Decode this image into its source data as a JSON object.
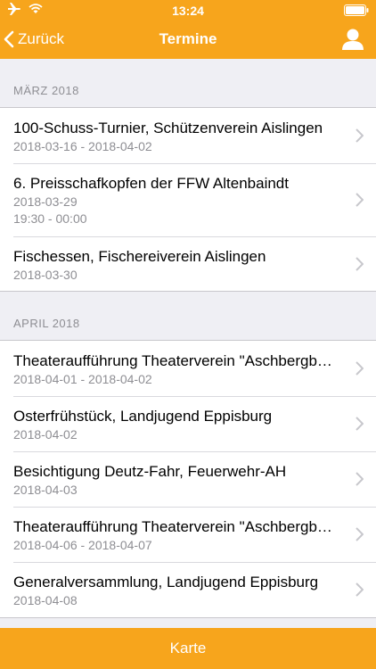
{
  "status_bar": {
    "time": "13:24"
  },
  "nav": {
    "back_label": "Zurück",
    "title": "Termine"
  },
  "sections": [
    {
      "header": "MÄRZ 2018",
      "items": [
        {
          "title": "100-Schuss-Turnier, Schützenverein Aislingen",
          "date": "2018-03-16 - 2018-04-02"
        },
        {
          "title": "6. Preisschafkopfen der FFW Altenbaindt",
          "date": "2018-03-29",
          "time": "19:30 - 00:00"
        },
        {
          "title": "Fischessen, Fischereiverein Aislingen",
          "date": "2018-03-30"
        }
      ]
    },
    {
      "header": "APRIL 2018",
      "items": [
        {
          "title": "Theateraufführung Theaterverein \"Aschbergb…",
          "date": "2018-04-01 - 2018-04-02"
        },
        {
          "title": "Osterfrühstück, Landjugend Eppisburg",
          "date": "2018-04-02"
        },
        {
          "title": "Besichtigung Deutz-Fahr, Feuerwehr-AH",
          "date": "2018-04-03"
        },
        {
          "title": "Theateraufführung Theaterverein \"Aschbergb…",
          "date": "2018-04-06 - 2018-04-07"
        },
        {
          "title": "Generalversammlung, Landjugend Eppisburg",
          "date": "2018-04-08"
        }
      ]
    }
  ],
  "bottom_bar": {
    "label": "Karte"
  },
  "colors": {
    "accent": "#f7a51c",
    "secondary_text": "#8e8e93"
  },
  "icons": [
    "airplane-icon",
    "wifi-icon",
    "battery-icon",
    "back-chevron-icon",
    "user-icon",
    "chevron-right-icon"
  ]
}
